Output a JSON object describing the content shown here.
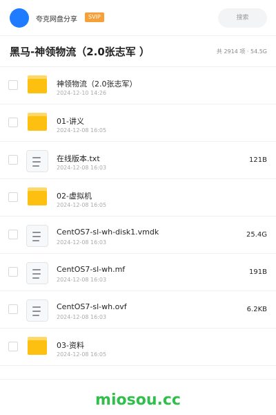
{
  "header": {
    "share_name": "夸克网盘分享",
    "svip_badge": "SVIP",
    "search_label": "搜索",
    "avatar_color": "#1f7bff"
  },
  "folder": {
    "title": "黑马-神领物流（2.0张志军 ）",
    "stats": "共 2914 项 · 54.5G"
  },
  "items": [
    {
      "type": "folder",
      "icon": "folder-icon",
      "name": "神领物流（2.0张志军）",
      "date": "2024-12-10 14:26",
      "size": ""
    },
    {
      "type": "folder",
      "icon": "folder-icon",
      "name": "01-讲义",
      "date": "2024-12-08 16:05",
      "size": ""
    },
    {
      "type": "file",
      "icon": "document-icon",
      "name": "在线版本.txt",
      "date": "2024-12-08 16:03",
      "size": "121B"
    },
    {
      "type": "folder",
      "icon": "folder-icon",
      "name": "02-虚拟机",
      "date": "2024-12-08 16:05",
      "size": ""
    },
    {
      "type": "file",
      "icon": "document-icon",
      "name": "CentOS7-sl-wh-disk1.vmdk",
      "date": "2024-12-08 16:03",
      "size": "25.4G"
    },
    {
      "type": "file",
      "icon": "document-icon",
      "name": "CentOS7-sl-wh.mf",
      "date": "2024-12-08 16:03",
      "size": "191B"
    },
    {
      "type": "file",
      "icon": "document-icon",
      "name": "CentOS7-sl-wh.ovf",
      "date": "2024-12-08 16:03",
      "size": "6.2KB"
    },
    {
      "type": "folder",
      "icon": "folder-icon",
      "name": "03-资料",
      "date": "2024-12-08 16:05",
      "size": ""
    }
  ],
  "footer": {
    "watermark": "miosou.cc",
    "watermark_color": "#2fbf4a"
  },
  "colors": {
    "folder": "#fdc011",
    "svip": "#f6a03a"
  }
}
